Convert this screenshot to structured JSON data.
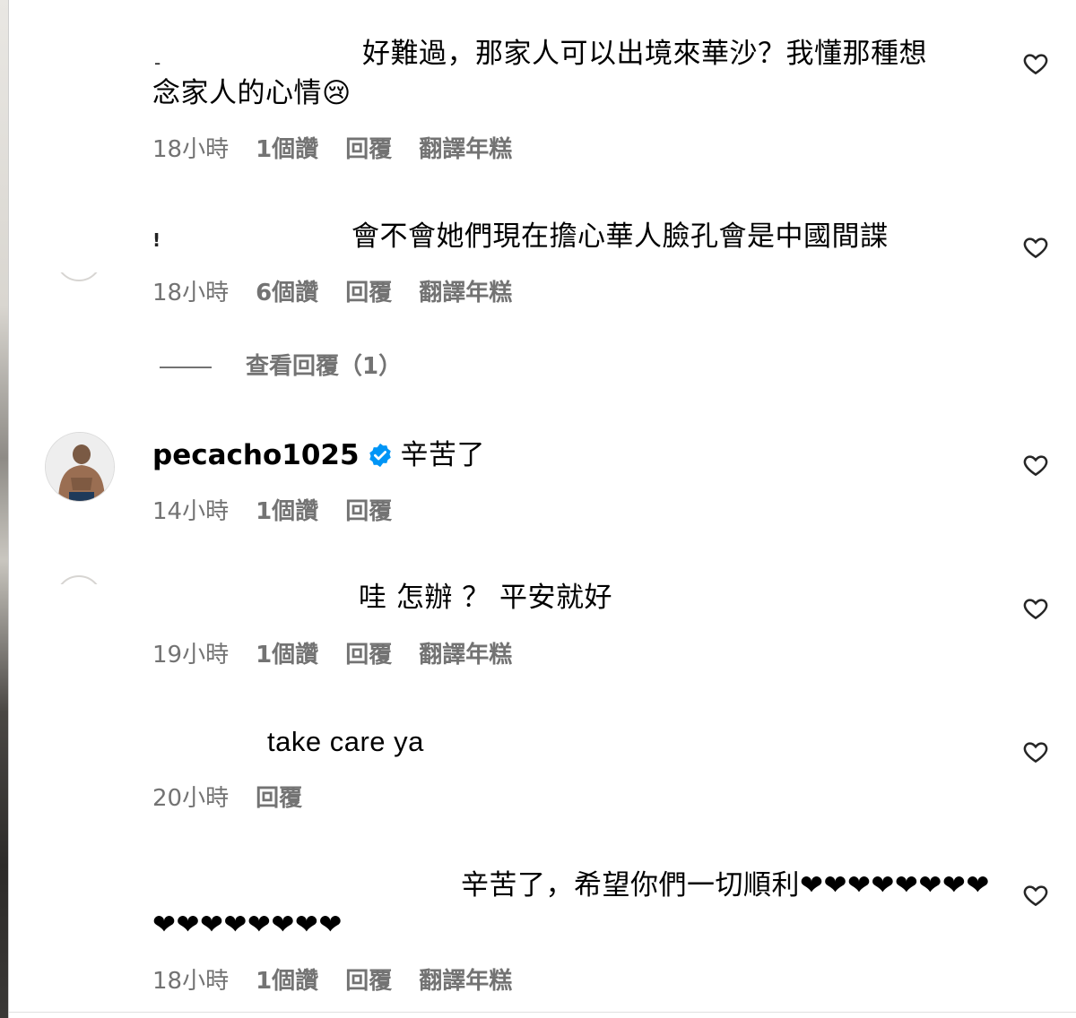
{
  "comments": [
    {
      "text_line1": "好難過，那家人可以出境來華沙？我懂那種想",
      "text_line2": "念家人的心情😢",
      "time": "18小時",
      "likes": "1個讚",
      "reply": "回覆",
      "translate": "翻譯年糕"
    },
    {
      "text_line1": "會不會她們現在擔心華人臉孔會是中國間諜",
      "time": "18小時",
      "likes": "6個讚",
      "reply": "回覆",
      "translate": "翻譯年糕",
      "view_replies": "查看回覆（1）"
    },
    {
      "username": "pecacho1025",
      "text_line1": "辛苦了",
      "time": "14小時",
      "likes": "1個讚",
      "reply": "回覆"
    },
    {
      "text_line1": "哇 怎辦 ？ 平安就好",
      "time": "19小時",
      "likes": "1個讚",
      "reply": "回覆",
      "translate": "翻譯年糕"
    },
    {
      "text_line1": "take care ya",
      "time": "20小時",
      "reply": "回覆"
    },
    {
      "text_line1": "辛苦了，希望你們一切順利❤❤❤❤❤❤❤❤",
      "text_line2": "❤❤❤❤❤❤❤❤",
      "time": "18小時",
      "likes": "1個讚",
      "reply": "回覆",
      "translate": "翻譯年糕"
    }
  ],
  "icons": {
    "heart": "heart-outline-icon",
    "verified": "verified-badge-icon",
    "verified_color": "#0095f6"
  },
  "colors": {
    "meta_text": "#737373",
    "body_text": "#000000"
  }
}
